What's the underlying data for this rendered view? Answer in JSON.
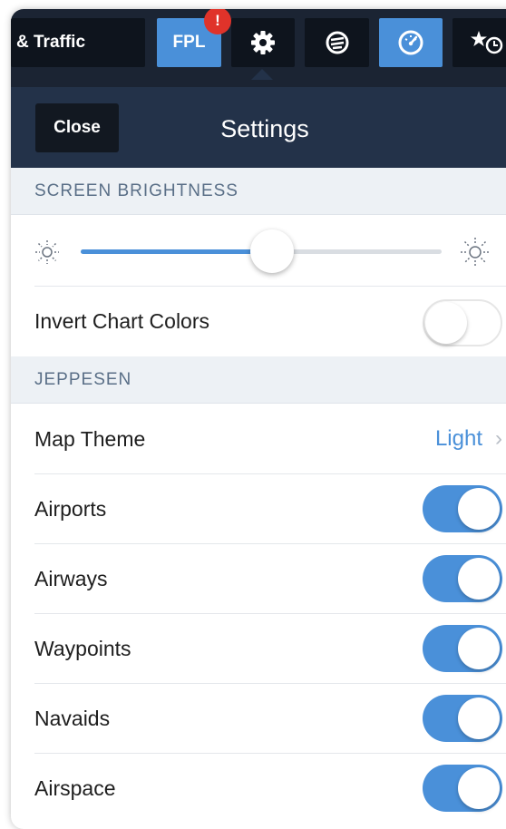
{
  "toolbar": {
    "traffic_label": "& Traffic",
    "fpl_label": "FPL",
    "fpl_badge": "!",
    "icons": [
      "gear-icon",
      "chart-icon",
      "gauge-icon",
      "star-clock-icon"
    ],
    "accent": "#4a90d9",
    "badge_color": "#e0332a"
  },
  "header": {
    "close_label": "Close",
    "title": "Settings"
  },
  "brightness": {
    "section_title": "SCREEN BRIGHTNESS",
    "level": 0.53,
    "low_icon": "sun-dim-icon",
    "high_icon": "sun-bright-icon"
  },
  "invert": {
    "label": "Invert Chart Colors",
    "on": false
  },
  "jeppesen": {
    "section_title": "JEPPESEN",
    "map_theme_label": "Map Theme",
    "map_theme_value": "Light",
    "items": [
      {
        "label": "Airports",
        "on": true
      },
      {
        "label": "Airways",
        "on": true
      },
      {
        "label": "Waypoints",
        "on": true
      },
      {
        "label": "Navaids",
        "on": true
      },
      {
        "label": "Airspace",
        "on": true
      }
    ]
  }
}
